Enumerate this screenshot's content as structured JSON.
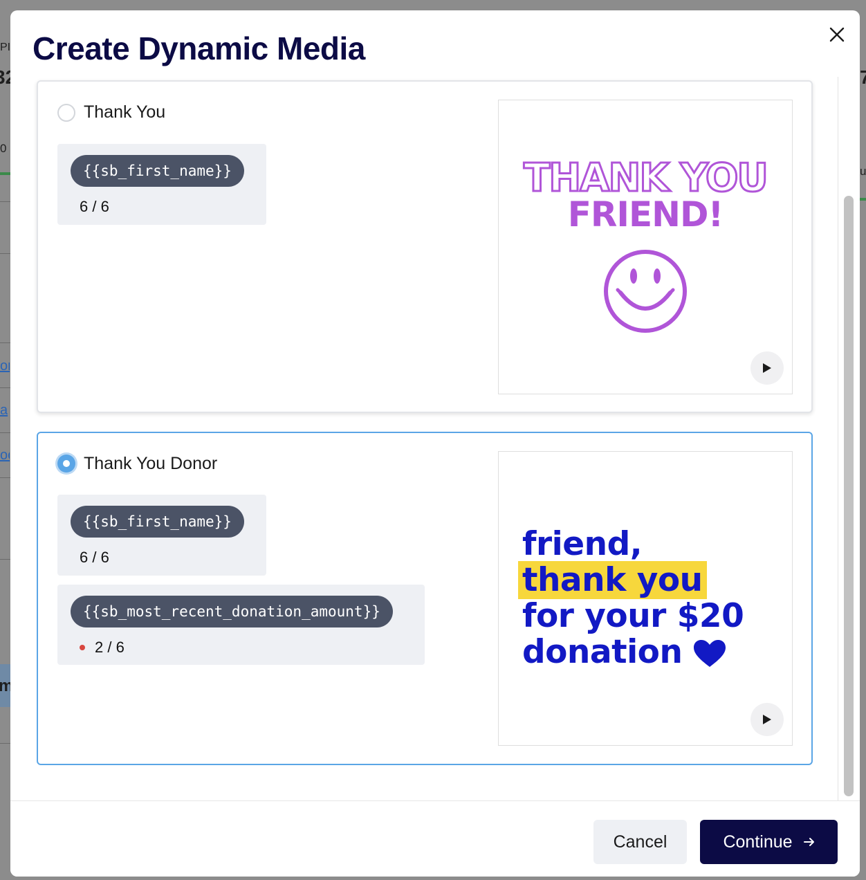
{
  "background": {
    "fragments": [
      "PI",
      "32",
      "0",
      "7/",
      "u",
      "m"
    ],
    "links": [
      "on",
      "a",
      "oc"
    ]
  },
  "modal": {
    "title": "Create Dynamic Media",
    "close_icon": "close-icon"
  },
  "options": [
    {
      "label": "Thank You",
      "selected": false,
      "variables": [
        {
          "token": "{{sb_first_name}}",
          "count": "6 / 6",
          "warning": false
        }
      ],
      "preview": {
        "line1": "THANK YOU",
        "line2": "FRIEND!",
        "accent_color": "#b055d8",
        "icon": "smiley-face-icon"
      }
    },
    {
      "label": "Thank You Donor",
      "selected": true,
      "variables": [
        {
          "token": "{{sb_first_name}}",
          "count": "6 / 6",
          "warning": false
        },
        {
          "token": "{{sb_most_recent_donation_amount}}",
          "count": "2 / 6",
          "warning": true
        }
      ],
      "preview": {
        "line1": "friend,",
        "line2": "thank you",
        "line3": "for your $20",
        "line4": "donation",
        "text_color": "#1219c4",
        "highlight_color": "#f7d73c",
        "icon": "heart-icon"
      }
    }
  ],
  "footer": {
    "cancel_label": "Cancel",
    "continue_label": "Continue"
  },
  "colors": {
    "primary": "#0c0b45",
    "selected_border": "#5aa5e6",
    "pill_bg": "#4b5366",
    "warning_dot": "#d8463f"
  }
}
